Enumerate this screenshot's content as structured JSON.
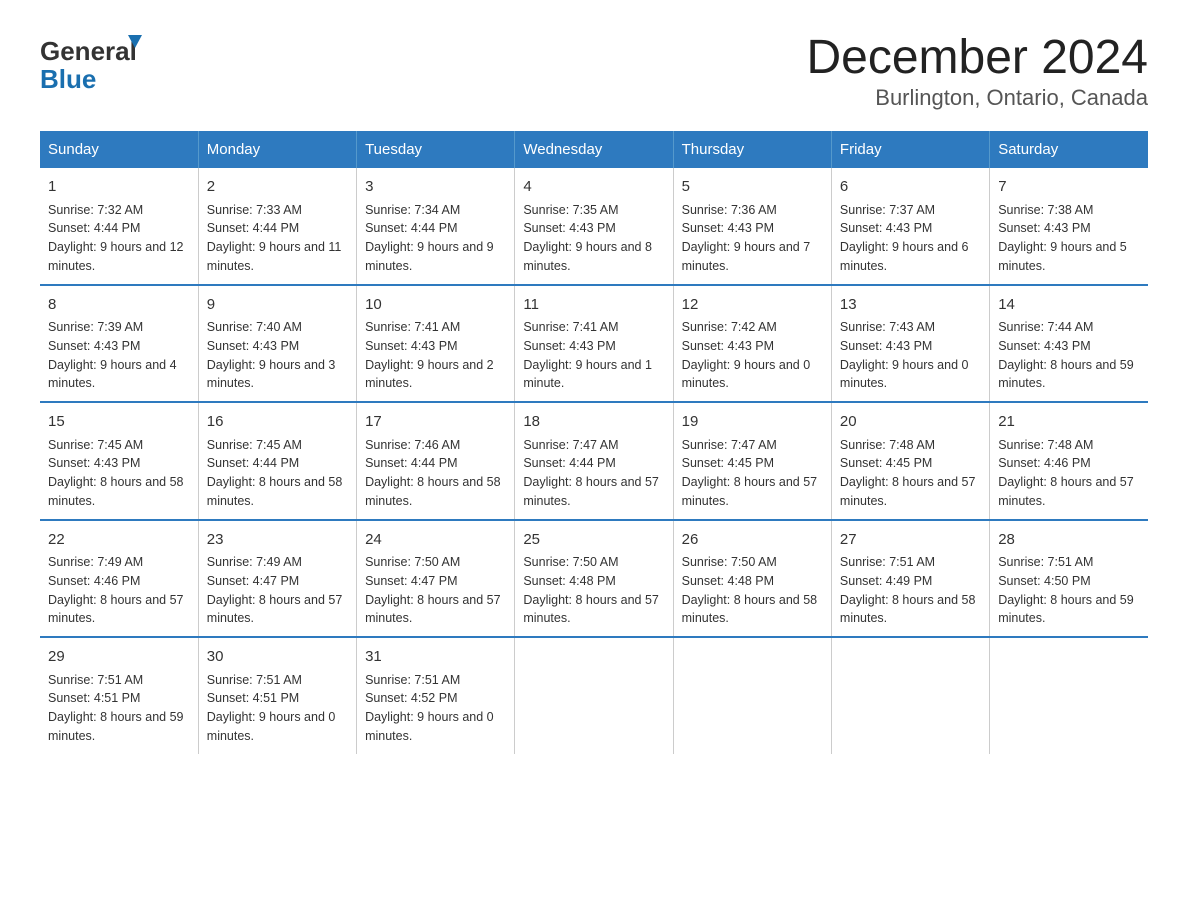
{
  "header": {
    "logo_general": "General",
    "logo_blue": "Blue",
    "month_year": "December 2024",
    "location": "Burlington, Ontario, Canada"
  },
  "days_of_week": [
    "Sunday",
    "Monday",
    "Tuesday",
    "Wednesday",
    "Thursday",
    "Friday",
    "Saturday"
  ],
  "weeks": [
    [
      {
        "day": "1",
        "sunrise": "7:32 AM",
        "sunset": "4:44 PM",
        "daylight": "9 hours and 12 minutes."
      },
      {
        "day": "2",
        "sunrise": "7:33 AM",
        "sunset": "4:44 PM",
        "daylight": "9 hours and 11 minutes."
      },
      {
        "day": "3",
        "sunrise": "7:34 AM",
        "sunset": "4:44 PM",
        "daylight": "9 hours and 9 minutes."
      },
      {
        "day": "4",
        "sunrise": "7:35 AM",
        "sunset": "4:43 PM",
        "daylight": "9 hours and 8 minutes."
      },
      {
        "day": "5",
        "sunrise": "7:36 AM",
        "sunset": "4:43 PM",
        "daylight": "9 hours and 7 minutes."
      },
      {
        "day": "6",
        "sunrise": "7:37 AM",
        "sunset": "4:43 PM",
        "daylight": "9 hours and 6 minutes."
      },
      {
        "day": "7",
        "sunrise": "7:38 AM",
        "sunset": "4:43 PM",
        "daylight": "9 hours and 5 minutes."
      }
    ],
    [
      {
        "day": "8",
        "sunrise": "7:39 AM",
        "sunset": "4:43 PM",
        "daylight": "9 hours and 4 minutes."
      },
      {
        "day": "9",
        "sunrise": "7:40 AM",
        "sunset": "4:43 PM",
        "daylight": "9 hours and 3 minutes."
      },
      {
        "day": "10",
        "sunrise": "7:41 AM",
        "sunset": "4:43 PM",
        "daylight": "9 hours and 2 minutes."
      },
      {
        "day": "11",
        "sunrise": "7:41 AM",
        "sunset": "4:43 PM",
        "daylight": "9 hours and 1 minute."
      },
      {
        "day": "12",
        "sunrise": "7:42 AM",
        "sunset": "4:43 PM",
        "daylight": "9 hours and 0 minutes."
      },
      {
        "day": "13",
        "sunrise": "7:43 AM",
        "sunset": "4:43 PM",
        "daylight": "9 hours and 0 minutes."
      },
      {
        "day": "14",
        "sunrise": "7:44 AM",
        "sunset": "4:43 PM",
        "daylight": "8 hours and 59 minutes."
      }
    ],
    [
      {
        "day": "15",
        "sunrise": "7:45 AM",
        "sunset": "4:43 PM",
        "daylight": "8 hours and 58 minutes."
      },
      {
        "day": "16",
        "sunrise": "7:45 AM",
        "sunset": "4:44 PM",
        "daylight": "8 hours and 58 minutes."
      },
      {
        "day": "17",
        "sunrise": "7:46 AM",
        "sunset": "4:44 PM",
        "daylight": "8 hours and 58 minutes."
      },
      {
        "day": "18",
        "sunrise": "7:47 AM",
        "sunset": "4:44 PM",
        "daylight": "8 hours and 57 minutes."
      },
      {
        "day": "19",
        "sunrise": "7:47 AM",
        "sunset": "4:45 PM",
        "daylight": "8 hours and 57 minutes."
      },
      {
        "day": "20",
        "sunrise": "7:48 AM",
        "sunset": "4:45 PM",
        "daylight": "8 hours and 57 minutes."
      },
      {
        "day": "21",
        "sunrise": "7:48 AM",
        "sunset": "4:46 PM",
        "daylight": "8 hours and 57 minutes."
      }
    ],
    [
      {
        "day": "22",
        "sunrise": "7:49 AM",
        "sunset": "4:46 PM",
        "daylight": "8 hours and 57 minutes."
      },
      {
        "day": "23",
        "sunrise": "7:49 AM",
        "sunset": "4:47 PM",
        "daylight": "8 hours and 57 minutes."
      },
      {
        "day": "24",
        "sunrise": "7:50 AM",
        "sunset": "4:47 PM",
        "daylight": "8 hours and 57 minutes."
      },
      {
        "day": "25",
        "sunrise": "7:50 AM",
        "sunset": "4:48 PM",
        "daylight": "8 hours and 57 minutes."
      },
      {
        "day": "26",
        "sunrise": "7:50 AM",
        "sunset": "4:48 PM",
        "daylight": "8 hours and 58 minutes."
      },
      {
        "day": "27",
        "sunrise": "7:51 AM",
        "sunset": "4:49 PM",
        "daylight": "8 hours and 58 minutes."
      },
      {
        "day": "28",
        "sunrise": "7:51 AM",
        "sunset": "4:50 PM",
        "daylight": "8 hours and 59 minutes."
      }
    ],
    [
      {
        "day": "29",
        "sunrise": "7:51 AM",
        "sunset": "4:51 PM",
        "daylight": "8 hours and 59 minutes."
      },
      {
        "day": "30",
        "sunrise": "7:51 AM",
        "sunset": "4:51 PM",
        "daylight": "9 hours and 0 minutes."
      },
      {
        "day": "31",
        "sunrise": "7:51 AM",
        "sunset": "4:52 PM",
        "daylight": "9 hours and 0 minutes."
      },
      null,
      null,
      null,
      null
    ]
  ],
  "labels": {
    "sunrise": "Sunrise:",
    "sunset": "Sunset:",
    "daylight": "Daylight:"
  }
}
